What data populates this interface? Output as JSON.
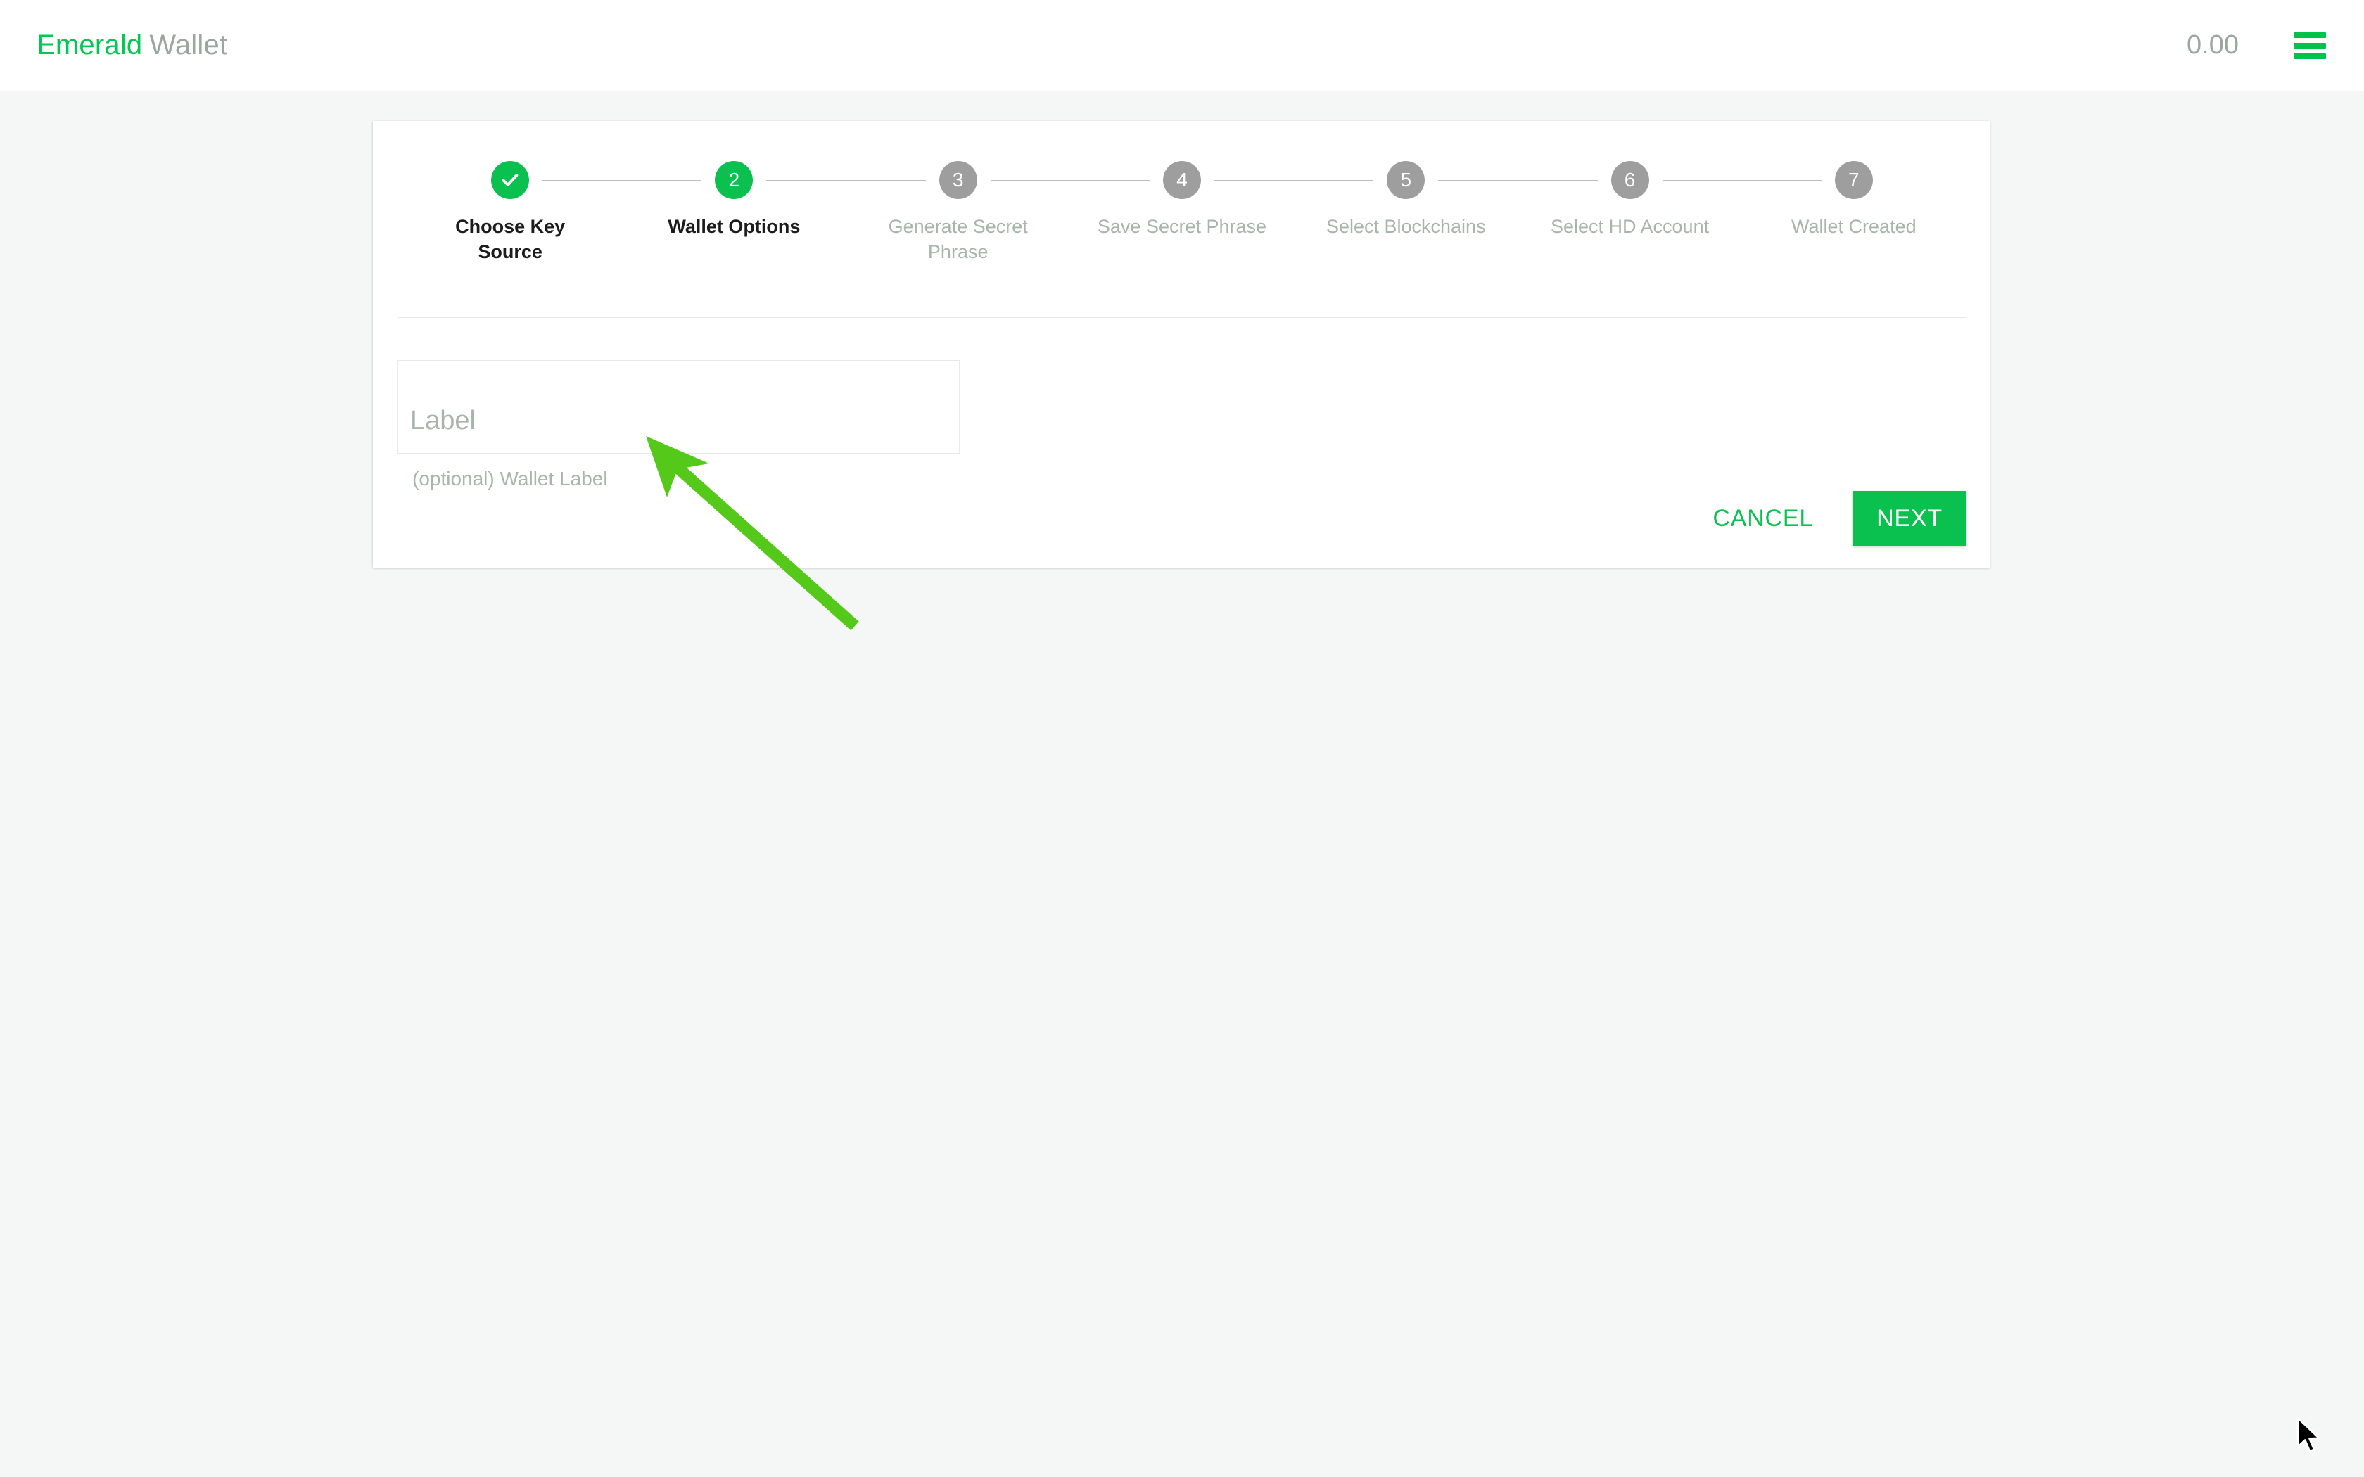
{
  "header": {
    "brand_primary": "Emerald",
    "brand_secondary": "Wallet",
    "balance": "0.00",
    "menu_icon": "hamburger-menu-icon",
    "brand_color": "#00c853",
    "muted_color": "#9aa7a0"
  },
  "stepper": {
    "steps": [
      {
        "number": "1",
        "label": "Choose Key Source",
        "state": "done"
      },
      {
        "number": "2",
        "label": "Wallet Options",
        "state": "current"
      },
      {
        "number": "3",
        "label": "Generate Secret\nPhrase",
        "state": "pending"
      },
      {
        "number": "4",
        "label": "Save Secret Phrase",
        "state": "pending"
      },
      {
        "number": "5",
        "label": "Select Blockchains",
        "state": "pending"
      },
      {
        "number": "6",
        "label": "Select HD Account",
        "state": "pending"
      },
      {
        "number": "7",
        "label": "Wallet Created",
        "state": "pending"
      }
    ],
    "done_icon": "check-icon",
    "active_color": "#0ac14f",
    "pending_color": "#9e9e9e"
  },
  "form": {
    "label_input": {
      "value": "",
      "placeholder": "Label",
      "helper_text": "(optional) Wallet Label"
    }
  },
  "actions": {
    "cancel_label": "CANCEL",
    "next_label": "NEXT"
  },
  "annotation": {
    "arrow_color": "#55c919",
    "arrow_name": "pointer-arrow-annotation"
  }
}
